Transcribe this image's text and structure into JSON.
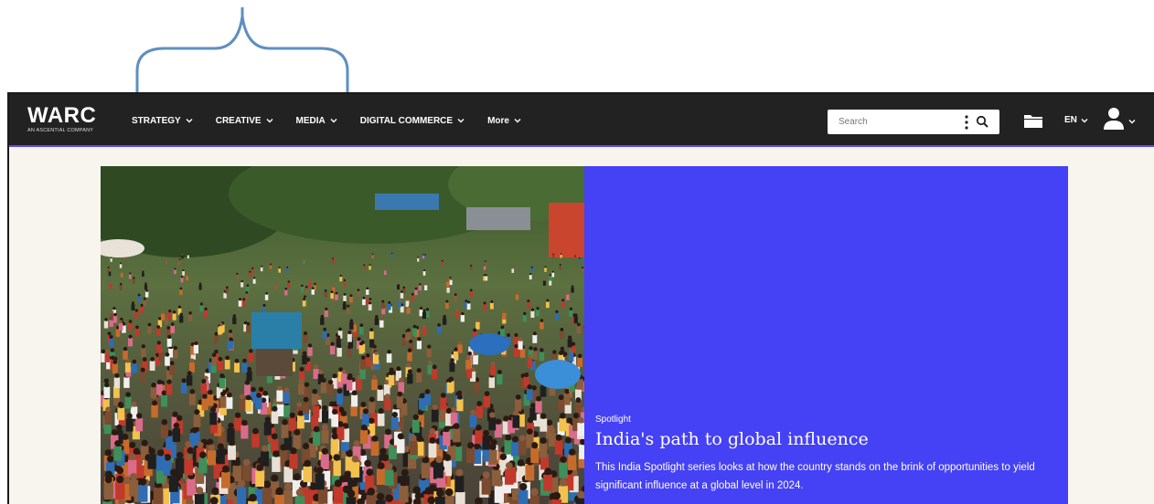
{
  "header": {
    "logo_wordmark": "WARC",
    "logo_tagline": "AN ASCENTIAL COMPANY",
    "nav": [
      {
        "label": "STRATEGY",
        "icon": "chevron-down-icon"
      },
      {
        "label": "CREATIVE",
        "icon": "chevron-down-icon"
      },
      {
        "label": "MEDIA",
        "icon": "chevron-down-icon"
      },
      {
        "label": "DIGITAL COMMERCE",
        "icon": "chevron-down-icon"
      },
      {
        "label": "More",
        "icon": "chevron-down-icon"
      }
    ],
    "search": {
      "placeholder": "Search"
    },
    "language": "EN",
    "colors": {
      "bar": "#222222",
      "accent_line": "#5b4bff"
    }
  },
  "hero": {
    "kicker": "Spotlight",
    "title": "India's path to global influence",
    "description": "This India Spotlight series looks at how the country stands on the brink of opportunities to yield significant influence at a global level in 2024.",
    "panel_color": "#4541f4",
    "image": "crowded-street-photo"
  }
}
